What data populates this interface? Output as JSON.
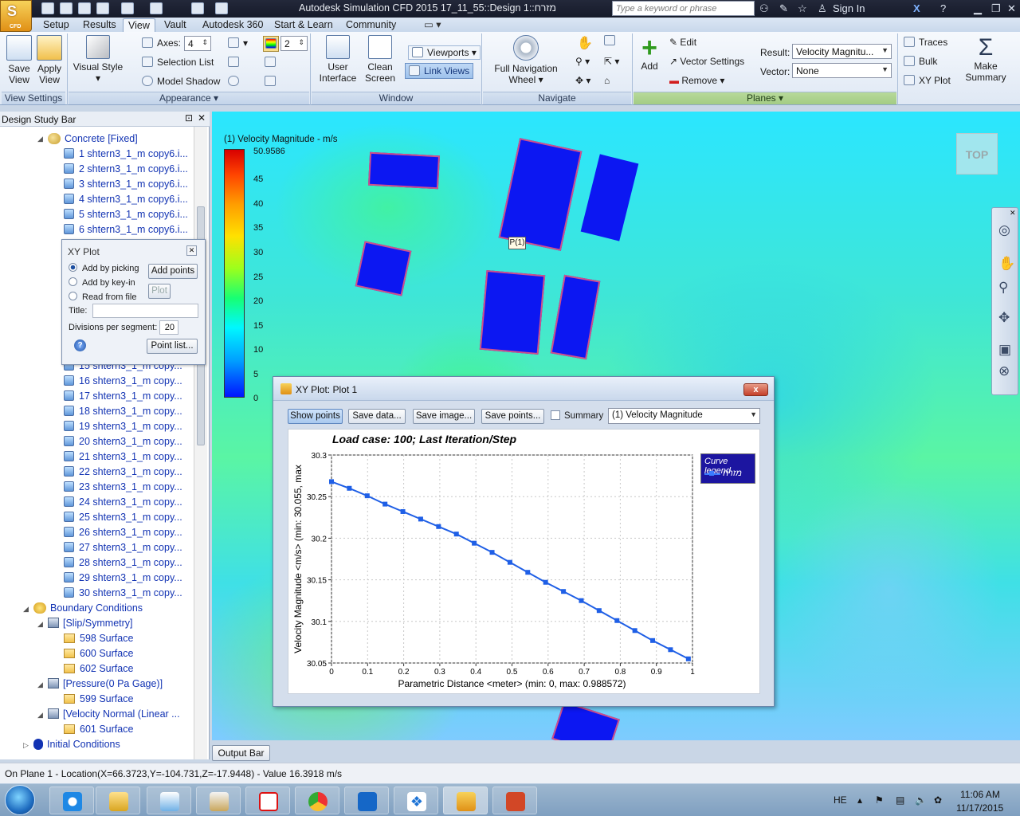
{
  "window": {
    "title": "Autodesk Simulation CFD 2015   17_11_55::Design 1::מזרח",
    "search_placeholder": "Type a keyword or phrase",
    "sign_in": "Sign In",
    "app_logo_label": "CFD"
  },
  "tabs": [
    "Setup",
    "Results",
    "View",
    "Vault",
    "Autodesk 360",
    "Start & Learn",
    "Community"
  ],
  "ribbon": {
    "save_view": "Save View",
    "apply_view": "Apply View",
    "visual_style": "Visual Style",
    "axes_label": "Axes:",
    "axes_value": "4",
    "selection_list": "Selection List",
    "model_shadow": "Model Shadow",
    "spinner_value": "2",
    "user_interface": "User Interface",
    "clean_screen": "Clean Screen",
    "viewports": "Viewports",
    "link_views": "Link Views",
    "full_nav_wheel": "Full Navigation Wheel",
    "add": "Add",
    "edit": "Edit",
    "vector_settings": "Vector Settings",
    "remove": "Remove",
    "result_label": "Result:",
    "result_value": "Velocity Magnitu...",
    "vector_label": "Vector:",
    "vector_value": "None",
    "traces": "Traces",
    "bulk": "Bulk",
    "xy_plot": "XY Plot",
    "make_summary": "Make Summary",
    "groups": {
      "view_settings": "View Settings",
      "appearance": "Appearance",
      "window": "Window",
      "navigate": "Navigate",
      "planes": "Planes"
    }
  },
  "design_study_bar": {
    "title": "Design Study Bar",
    "material_group": "Concrete [Fixed]",
    "parts_top": [
      "1 shtern3_1_m copy6.i...",
      "2 shtern3_1_m copy6.i...",
      "3 shtern3_1_m copy6.i...",
      "4 shtern3_1_m copy6.i...",
      "5 shtern3_1_m copy6.i...",
      "6 shtern3_1_m copy6.i..."
    ],
    "parts_bottom": [
      "15 shtern3_1_m copy...",
      "16 shtern3_1_m copy...",
      "17 shtern3_1_m copy...",
      "18 shtern3_1_m copy...",
      "19 shtern3_1_m copy...",
      "20 shtern3_1_m copy...",
      "21 shtern3_1_m copy...",
      "22 shtern3_1_m copy...",
      "23 shtern3_1_m copy...",
      "24 shtern3_1_m copy...",
      "25 shtern3_1_m copy...",
      "26 shtern3_1_m copy...",
      "27 shtern3_1_m copy...",
      "28 shtern3_1_m copy...",
      "29 shtern3_1_m copy...",
      "30 shtern3_1_m copy..."
    ],
    "boundary_conditions": "Boundary Conditions",
    "slip": "[Slip/Symmetry]",
    "slip_items": [
      "598 Surface",
      "600 Surface",
      "602 Surface"
    ],
    "pressure": "[Pressure(0 Pa Gage)]",
    "pressure_items": [
      "599 Surface"
    ],
    "velocity": "[Velocity Normal (Linear ...",
    "velocity_items": [
      "601 Surface"
    ],
    "initial_conditions": "Initial Conditions"
  },
  "xy_panel": {
    "title": "XY Plot",
    "add_by_picking": "Add by picking",
    "add_by_keyin": "Add by key-in",
    "read_from_file": "Read from file",
    "add_points": "Add points",
    "plot": "Plot",
    "title_label": "Title:",
    "title_value": "",
    "divisions_label": "Divisions per segment:",
    "divisions_value": "20",
    "point_list": "Point list..."
  },
  "viewport": {
    "legend_title": "(1) Velocity Magnitude - m/s",
    "legend_max": "50.9586",
    "legend_ticks": [
      "45",
      "40",
      "35",
      "30",
      "25",
      "20",
      "15",
      "10",
      "5",
      "0"
    ],
    "point_label": "P(1)",
    "viewcube": "TOP"
  },
  "xy_window": {
    "title": "XY Plot: Plot 1",
    "show_points": "Show points",
    "save_data": "Save data...",
    "save_image": "Save image...",
    "save_points": "Save points...",
    "summary": "Summary",
    "result_select": "(1) Velocity Magnitude",
    "close": "x"
  },
  "chart_data": {
    "type": "line",
    "title": "Load case: 100; Last Iteration/Step",
    "xlabel": "Parametric Distance <meter> (min: 0, max: 0.988572)",
    "ylabel": "Velocity Magnitude <m/s> (min: 30.055, max",
    "xlim": [
      0,
      1
    ],
    "ylim": [
      30.05,
      30.3
    ],
    "x_ticks": [
      "0",
      "0.1",
      "0.2",
      "0.3",
      "0.4",
      "0.5",
      "0.6",
      "0.7",
      "0.8",
      "0.9",
      "1"
    ],
    "y_ticks": [
      "30.3",
      "30.25",
      "30.2",
      "30.15",
      "30.1",
      "30.05"
    ],
    "grid": true,
    "legend_title": "Curve legend",
    "series": [
      {
        "name": "מזרח",
        "color": "#1f5fe6",
        "x": [
          0.0,
          0.0494,
          0.0989,
          0.1483,
          0.1977,
          0.2471,
          0.2966,
          0.346,
          0.3954,
          0.4449,
          0.4943,
          0.5437,
          0.5931,
          0.6426,
          0.692,
          0.7414,
          0.7909,
          0.8403,
          0.8897,
          0.9391,
          0.9886
        ],
        "y": [
          30.268,
          30.26,
          30.251,
          30.241,
          30.232,
          30.223,
          30.214,
          30.205,
          30.194,
          30.183,
          30.171,
          30.159,
          30.147,
          30.136,
          30.125,
          30.113,
          30.101,
          30.089,
          30.077,
          30.066,
          30.055
        ]
      }
    ]
  },
  "bottom": {
    "output_bar": "Output Bar",
    "status": "On Plane 1 - Location(X=66.3723,Y=-104.731,Z=-17.9448) - Value 16.3918  m/s"
  },
  "taskbar": {
    "lang": "HE",
    "time": "11:06 AM",
    "date": "11/17/2015",
    "apps": [
      "internet-explorer",
      "file-explorer",
      "notepad",
      "paint",
      "acrobat",
      "chrome",
      "outlook",
      "dropbox",
      "cfd",
      "powerpoint"
    ]
  }
}
